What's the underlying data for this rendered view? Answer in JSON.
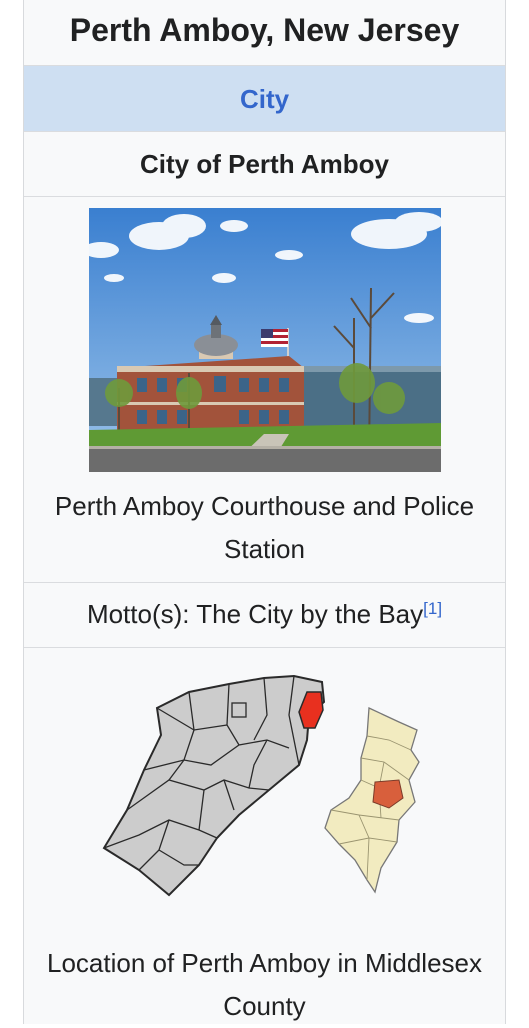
{
  "infobox": {
    "title": "Perth Amboy, New Jersey",
    "type_label": "City",
    "official_name": "City of Perth Amboy",
    "photo": {
      "caption": "Perth Amboy Courthouse and Police Station"
    },
    "motto": {
      "text": "Motto(s): The City by the Bay",
      "ref": "[1]"
    },
    "map": {
      "caption": "Location of Perth Amboy in Middlesex County"
    }
  },
  "colors": {
    "type_band": "#cedff2",
    "link": "#3366cc",
    "highlight": "#e8301f",
    "county_fill": "#cccccc",
    "state_fill": "#f2ebc0"
  }
}
